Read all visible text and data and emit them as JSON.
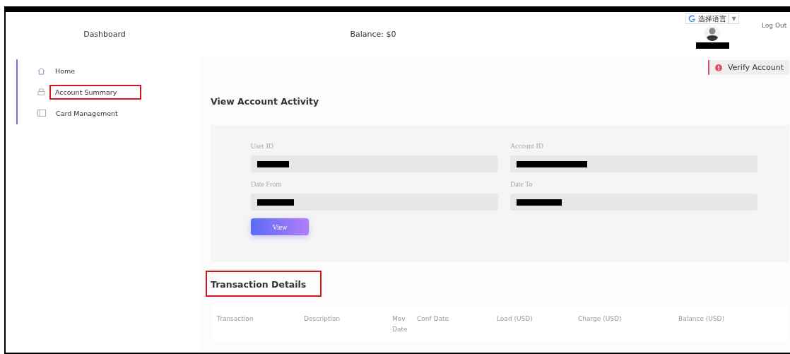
{
  "header": {
    "title": "Dashboard",
    "balance": "Balance: $0",
    "language": "选择语言",
    "language_caret": "▼",
    "logout": "Log Out"
  },
  "sidebar": {
    "items": [
      {
        "label": "Home",
        "kind": "home",
        "highlighted": false
      },
      {
        "label": "Account Summary",
        "kind": "summary",
        "highlighted": true
      },
      {
        "label": "Card Management",
        "kind": "card",
        "highlighted": false
      }
    ]
  },
  "verify_button": "Verify Account",
  "activity": {
    "title": "View Account Activity",
    "fields": [
      {
        "label": "User ID"
      },
      {
        "label": "Account ID"
      },
      {
        "label": "Date From"
      },
      {
        "label": "Date To"
      }
    ],
    "button": "View"
  },
  "transactions": {
    "title": "Transaction Details",
    "highlighted": true,
    "columns": [
      "Transaction",
      "Description",
      "Mov Date",
      "Conf Date",
      "Load (USD)",
      "Charge (USD)",
      "Balance (USD)"
    ]
  }
}
